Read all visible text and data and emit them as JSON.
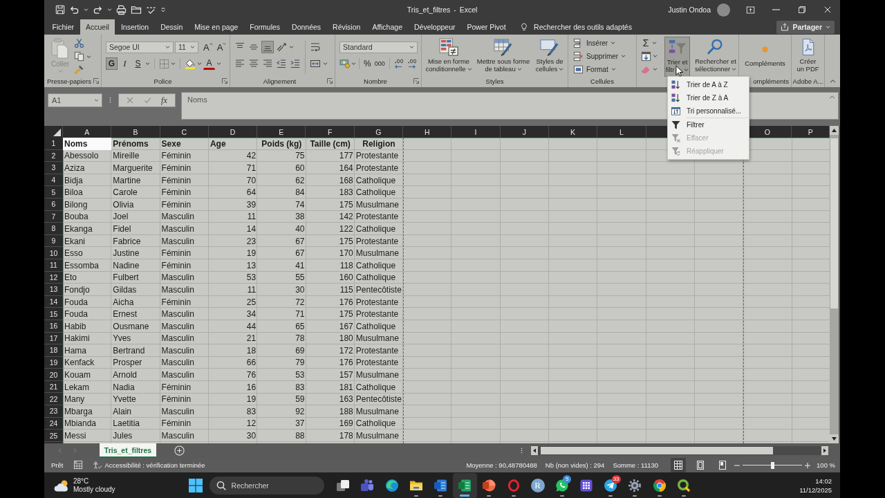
{
  "title_bar": {
    "title": "Tris_et_filtres - Excel",
    "user": "Justin Ondoa"
  },
  "menu_tabs": [
    {
      "label": "Fichier",
      "selected": false
    },
    {
      "label": "Accueil",
      "selected": true
    },
    {
      "label": "Insertion",
      "selected": false
    },
    {
      "label": "Dessin",
      "selected": false
    },
    {
      "label": "Mise en page",
      "selected": false
    },
    {
      "label": "Formules",
      "selected": false
    },
    {
      "label": "Données",
      "selected": false
    },
    {
      "label": "Révision",
      "selected": false
    },
    {
      "label": "Affichage",
      "selected": false
    },
    {
      "label": "Développeur",
      "selected": false
    },
    {
      "label": "Power Pivot",
      "selected": false
    }
  ],
  "tell_me": {
    "label": "Rechercher des outils adaptés"
  },
  "share": {
    "label": "Partager"
  },
  "ribbon": {
    "clipboard": {
      "paste": {
        "label": "Coller",
        "disabled": true
      },
      "group_label": "Presse-papiers"
    },
    "font": {
      "font_name": "Segoe UI",
      "font_size": "11",
      "grow_label": "A",
      "shrink_label": "A",
      "style_buttons": [
        {
          "kind": "bold",
          "label": "G",
          "pressed": true
        },
        {
          "kind": "italic",
          "label": "I",
          "pressed": false
        },
        {
          "kind": "underline",
          "label": "S",
          "pressed": false
        }
      ],
      "font_color_label": "A",
      "group_label": "Police"
    },
    "alignment": {
      "vertical_buttons": [
        {
          "kind": "top",
          "selected": false
        },
        {
          "kind": "middle",
          "selected": false
        },
        {
          "kind": "bottom",
          "selected": true
        }
      ],
      "horizontal_buttons": [
        {
          "kind": "left",
          "selected": false
        },
        {
          "kind": "center",
          "selected": false
        },
        {
          "kind": "right",
          "selected": false
        }
      ],
      "group_label": "Alignement"
    },
    "number": {
      "format": "Standard",
      "percent_label": "%",
      "thousands_label": "000",
      "group_label": "Nombre"
    },
    "styles": {
      "buttons": [
        {
          "kind": "conditional",
          "label": "Mise en forme conditionnelle"
        },
        {
          "kind": "table",
          "label": "Mettre sous forme de tableau"
        },
        {
          "kind": "cell-styles",
          "label": "Styles de cellules"
        }
      ],
      "group_label": "Styles"
    },
    "cells": {
      "buttons": [
        {
          "kind": "insert",
          "label": "Insérer"
        },
        {
          "kind": "delete",
          "label": "Supprimer"
        },
        {
          "kind": "format",
          "label": "Format"
        }
      ],
      "group_label": "Cellules"
    },
    "editing": {
      "autosum_label": "Σ",
      "sort_filter": {
        "label": "Trier et filtr",
        "pressed": true
      },
      "find": {
        "label": "Rechercher et sélectionner"
      }
    },
    "addins": {
      "button_label": "Compléments",
      "group_label": "ompléments"
    },
    "adobe": {
      "button_label": "Créer un PDF",
      "group_label": "Adobe A..."
    }
  },
  "formula_bar": {
    "name_box": "A1",
    "function_label": "fx",
    "value": "Noms",
    "confirm_enabled": false
  },
  "sheet": {
    "all_selected": true,
    "columns": [
      "A",
      "B",
      "C",
      "D",
      "E",
      "F",
      "G",
      "H",
      "I",
      "J",
      "K",
      "L"
    ],
    "columns_after_menu": [
      "O",
      "P"
    ],
    "header_row": {
      "number": "1",
      "cells": [
        {
          "text": "Noms",
          "kind": "text",
          "centered": false,
          "active": true
        },
        {
          "text": "Prénoms",
          "kind": "text",
          "centered": false,
          "active": false
        },
        {
          "text": "Sexe",
          "kind": "text",
          "centered": false,
          "active": false
        },
        {
          "text": "Age",
          "kind": "number",
          "centered": false,
          "active": false
        },
        {
          "text": "Poids (kg)",
          "kind": "number",
          "centered": true,
          "active": false
        },
        {
          "text": "Taille (cm)",
          "kind": "number",
          "centered": true,
          "active": false
        },
        {
          "text": "Religion",
          "kind": "text",
          "centered": true,
          "active": false
        }
      ]
    },
    "rows": [
      {
        "number": "2",
        "cells": [
          "Abessolo",
          "Mireille",
          "Féminin",
          "42",
          "75",
          "177",
          "Protestante"
        ]
      },
      {
        "number": "3",
        "cells": [
          "Aziza",
          "Marguerite",
          "Féminin",
          "71",
          "60",
          "164",
          "Protestante"
        ]
      },
      {
        "number": "4",
        "cells": [
          "Bidja",
          "Martine",
          "Féminin",
          "70",
          "62",
          "168",
          "Catholique"
        ]
      },
      {
        "number": "5",
        "cells": [
          "Biloa",
          "Carole",
          "Féminin",
          "64",
          "84",
          "183",
          "Catholique"
        ]
      },
      {
        "number": "6",
        "cells": [
          "Bilong",
          "Olivia",
          "Féminin",
          "39",
          "74",
          "175",
          "Musulmane"
        ]
      },
      {
        "number": "7",
        "cells": [
          "Bouba",
          "Joel",
          "Masculin",
          "11",
          "38",
          "142",
          "Protestante"
        ]
      },
      {
        "number": "8",
        "cells": [
          "Ekanga",
          "Fidel",
          "Masculin",
          "14",
          "40",
          "122",
          "Catholique"
        ]
      },
      {
        "number": "9",
        "cells": [
          "Ekani",
          "Fabrice",
          "Masculin",
          "23",
          "67",
          "175",
          "Protestante"
        ]
      },
      {
        "number": "10",
        "cells": [
          "Esso",
          "Justine",
          "Féminin",
          "19",
          "67",
          "170",
          "Musulmane"
        ]
      },
      {
        "number": "11",
        "cells": [
          "Essomba",
          "Nadine",
          "Féminin",
          "13",
          "41",
          "118",
          "Catholique"
        ]
      },
      {
        "number": "12",
        "cells": [
          "Eto",
          "Fulbert",
          "Masculin",
          "53",
          "55",
          "160",
          "Catholique"
        ]
      },
      {
        "number": "13",
        "cells": [
          "Fondjo",
          "Gildas",
          "Masculin",
          "11",
          "30",
          "115",
          "Pentecôtiste"
        ]
      },
      {
        "number": "14",
        "cells": [
          "Fouda",
          "Aicha",
          "Féminin",
          "25",
          "72",
          "176",
          "Protestante"
        ]
      },
      {
        "number": "15",
        "cells": [
          "Fouda",
          "Ernest",
          "Masculin",
          "34",
          "71",
          "175",
          "Protestante"
        ]
      },
      {
        "number": "16",
        "cells": [
          "Habib",
          "Ousmane",
          "Masculin",
          "44",
          "65",
          "167",
          "Catholique"
        ]
      },
      {
        "number": "17",
        "cells": [
          "Hakimi",
          "Yves",
          "Masculin",
          "21",
          "78",
          "180",
          "Musulmane"
        ]
      },
      {
        "number": "18",
        "cells": [
          "Hama",
          "Bertrand",
          "Masculin",
          "18",
          "69",
          "172",
          "Protestante"
        ]
      },
      {
        "number": "19",
        "cells": [
          "Kenfack",
          "Prosper",
          "Masculin",
          "66",
          "79",
          "176",
          "Protestante"
        ]
      },
      {
        "number": "20",
        "cells": [
          "Kouam",
          "Arnold",
          "Masculin",
          "76",
          "53",
          "157",
          "Musulmane"
        ]
      },
      {
        "number": "21",
        "cells": [
          "Lekam",
          "Nadia",
          "Féminin",
          "16",
          "83",
          "181",
          "Catholique"
        ]
      },
      {
        "number": "22",
        "cells": [
          "Many",
          "Yvette",
          "Féminin",
          "19",
          "59",
          "163",
          "Pentecôtiste"
        ]
      },
      {
        "number": "23",
        "cells": [
          "Mbarga",
          "Alain",
          "Masculin",
          "83",
          "92",
          "188",
          "Musulmane"
        ]
      },
      {
        "number": "24",
        "cells": [
          "Mbianda",
          "Laetitia",
          "Féminin",
          "12",
          "37",
          "169",
          "Catholique"
        ]
      },
      {
        "number": "25",
        "cells": [
          "Messi",
          "Jules",
          "Masculin",
          "30",
          "88",
          "178",
          "Musulmane"
        ]
      }
    ]
  },
  "sort_menu": {
    "sections": [
      {
        "items": [
          {
            "kind": "sort-ascending",
            "label": "Trier de A à Z",
            "disabled": false
          },
          {
            "kind": "sort-descending",
            "label": "Trier de Z à A",
            "disabled": false
          },
          {
            "kind": "custom-sort",
            "label": "Tri personnalisé...",
            "disabled": false
          }
        ]
      },
      {
        "items": [
          {
            "kind": "filter",
            "label": "Filtrer",
            "disabled": false
          },
          {
            "kind": "clear-filter",
            "label": "Effacer",
            "disabled": true
          },
          {
            "kind": "reapply",
            "label": "Réappliquer",
            "disabled": true
          }
        ]
      }
    ]
  },
  "sheet_tabs": [
    {
      "label": "Tris_et_filtres",
      "selected": true
    }
  ],
  "status_bar": {
    "mode": "Prêt",
    "accessibility": "Accessibilité : vérification terminée",
    "average": "Moyenne : 90,48780488",
    "count": "Nb (non vides) : 294",
    "sum": "Somme : 11130",
    "views": [
      {
        "kind": "normal",
        "selected": true
      },
      {
        "kind": "page-layout",
        "selected": false
      },
      {
        "kind": "page-break",
        "selected": false
      }
    ],
    "zoom": {
      "level": 0.5,
      "label": "100 %"
    }
  },
  "taskbar": {
    "weather": {
      "temperature": "28°C",
      "condition": "Mostly cloudy"
    },
    "search": {
      "placeholder": "Rechercher"
    },
    "apps": [
      {
        "kind": "task-view",
        "running": false,
        "active": false
      },
      {
        "kind": "people",
        "running": false,
        "active": false
      },
      {
        "kind": "swirl",
        "running": false,
        "active": false
      },
      {
        "kind": "folder",
        "running": true,
        "active": false
      },
      {
        "kind": "document",
        "running": true,
        "active": false
      },
      {
        "kind": "spreadsheet",
        "running": true,
        "active": true
      },
      {
        "kind": "presentation",
        "running": true,
        "active": false
      },
      {
        "kind": "ring",
        "running": true,
        "active": false
      },
      {
        "kind": "letter",
        "label": "R",
        "running": false,
        "active": false
      },
      {
        "kind": "chat",
        "running": true,
        "active": false,
        "badge": {
          "text": "5",
          "color": "#3b8fd9"
        }
      },
      {
        "kind": "grid",
        "running": false,
        "active": false
      },
      {
        "kind": "plane",
        "running": true,
        "active": false,
        "badge": {
          "text": "33",
          "color": "#d9343a"
        }
      },
      {
        "kind": "gear",
        "running": true,
        "active": false
      },
      {
        "kind": "tricolor",
        "running": true,
        "active": false
      },
      {
        "kind": "q-ring",
        "running": true,
        "active": false
      }
    ],
    "time": "14:02",
    "date": "11/12/2025"
  }
}
